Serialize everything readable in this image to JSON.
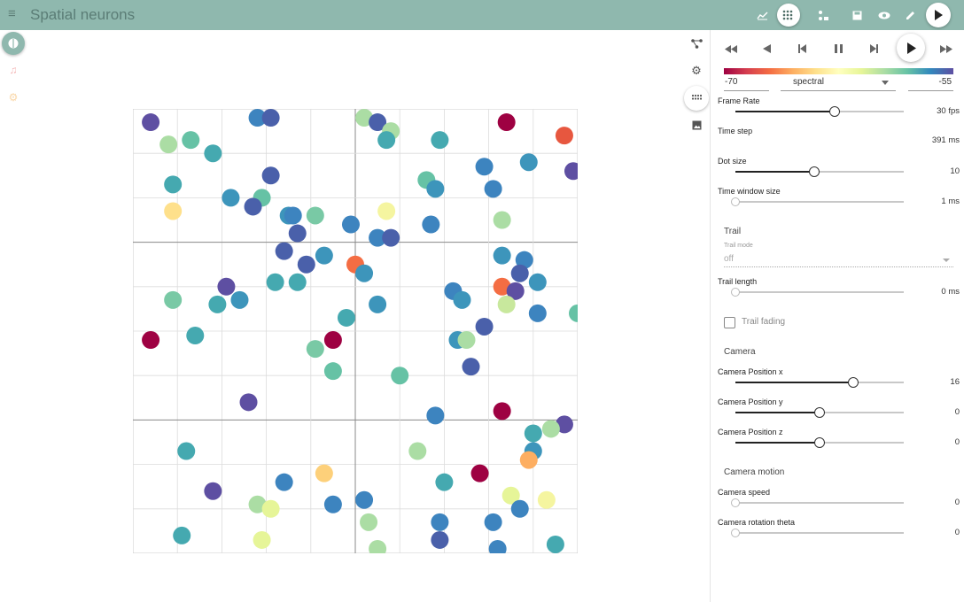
{
  "app": {
    "title": "Spatial neurons"
  },
  "topbar": {
    "icons": [
      {
        "name": "chart-icon",
        "glyph": "📈"
      },
      {
        "name": "grid-dots-icon",
        "glyph": "⋮⋮",
        "active": true
      },
      {
        "name": "model-icon",
        "glyph": "⛶"
      },
      {
        "name": "save-icon",
        "glyph": "💾"
      },
      {
        "name": "eye-icon",
        "glyph": "👁"
      },
      {
        "name": "edit-icon",
        "glyph": "✎"
      }
    ]
  },
  "left_rail": [
    {
      "name": "brain-icon",
      "color": "#ffffff"
    },
    {
      "name": "music-icon",
      "color": "#f4b6b6"
    },
    {
      "name": "settings-icon",
      "color": "#f9d7a8"
    }
  ],
  "colorbar": {
    "colormap": "spectral",
    "min_label": "-70",
    "max_label": "-55"
  },
  "controls": {
    "frame_rate": {
      "label": "Frame Rate",
      "value": "30 fps",
      "fraction": 0.59
    },
    "time_step": {
      "label": "Time step",
      "value": "391 ms"
    },
    "dot_size": {
      "label": "Dot size",
      "value": "10",
      "fraction": 0.47
    },
    "time_window": {
      "label": "Time window size",
      "value": "1 ms",
      "fraction": 0.0
    },
    "trail_section": "Trail",
    "trail_mode_label": "Trail mode",
    "trail_mode_value": "off",
    "trail_length": {
      "label": "Trail length",
      "value": "0 ms",
      "fraction": 0.0
    },
    "trail_fading": {
      "label": "Trail fading",
      "checked": false
    },
    "camera_section": "Camera",
    "camera_x": {
      "label": "Camera Position x",
      "value": "16",
      "fraction": 0.7
    },
    "camera_y": {
      "label": "Camera Position y",
      "value": "0",
      "fraction": 0.5
    },
    "camera_z": {
      "label": "Camera Position z",
      "value": "0",
      "fraction": 0.5
    },
    "camera_motion_section": "Camera motion",
    "camera_speed": {
      "label": "Camera speed",
      "value": "0",
      "fraction": 0.0
    },
    "camera_rotation_theta": {
      "label": "Camera rotation theta",
      "value": "0",
      "fraction": 0.0
    }
  },
  "chart_data": {
    "type": "scatter",
    "xlim": [
      0,
      10
    ],
    "ylim": [
      0,
      10
    ],
    "grid": true,
    "color_scale": "spectral",
    "points": [
      {
        "x": 0.4,
        "y": 9.7,
        "c": "#5e4fa2"
      },
      {
        "x": 1.3,
        "y": 9.3,
        "c": "#66c2a5"
      },
      {
        "x": 0.8,
        "y": 9.2,
        "c": "#abdda4"
      },
      {
        "x": 1.8,
        "y": 9.0,
        "c": "#45a9b0"
      },
      {
        "x": 2.8,
        "y": 9.8,
        "c": "#3d84bf"
      },
      {
        "x": 3.1,
        "y": 9.8,
        "c": "#4a60aa"
      },
      {
        "x": 5.2,
        "y": 9.8,
        "c": "#abdda4"
      },
      {
        "x": 5.5,
        "y": 9.7,
        "c": "#4a60aa"
      },
      {
        "x": 5.8,
        "y": 9.5,
        "c": "#abdda4"
      },
      {
        "x": 5.7,
        "y": 9.3,
        "c": "#45a9b0"
      },
      {
        "x": 6.9,
        "y": 9.3,
        "c": "#45a9b0"
      },
      {
        "x": 8.4,
        "y": 9.7,
        "c": "#9e0142"
      },
      {
        "x": 9.7,
        "y": 9.4,
        "c": "#e7573f"
      },
      {
        "x": 0.9,
        "y": 8.3,
        "c": "#45a9b0"
      },
      {
        "x": 3.1,
        "y": 8.5,
        "c": "#4a60aa"
      },
      {
        "x": 7.9,
        "y": 8.7,
        "c": "#3d84bf"
      },
      {
        "x": 8.9,
        "y": 8.8,
        "c": "#3d95bb"
      },
      {
        "x": 9.9,
        "y": 8.6,
        "c": "#5e4fa2"
      },
      {
        "x": 6.6,
        "y": 8.4,
        "c": "#66c2a5"
      },
      {
        "x": 6.8,
        "y": 8.2,
        "c": "#3d95bb"
      },
      {
        "x": 8.1,
        "y": 8.2,
        "c": "#3d84bf"
      },
      {
        "x": 2.2,
        "y": 8.0,
        "c": "#3d95bb"
      },
      {
        "x": 2.9,
        "y": 8.0,
        "c": "#66c2a5"
      },
      {
        "x": 2.7,
        "y": 7.8,
        "c": "#4a60aa"
      },
      {
        "x": 0.9,
        "y": 7.7,
        "c": "#fee08b"
      },
      {
        "x": 3.5,
        "y": 7.6,
        "c": "#3d95bb"
      },
      {
        "x": 3.6,
        "y": 7.6,
        "c": "#3d84bf"
      },
      {
        "x": 4.1,
        "y": 7.6,
        "c": "#79c9a5"
      },
      {
        "x": 5.7,
        "y": 7.7,
        "c": "#f5f5a0"
      },
      {
        "x": 4.9,
        "y": 7.4,
        "c": "#3d84bf"
      },
      {
        "x": 8.3,
        "y": 7.5,
        "c": "#abdda4"
      },
      {
        "x": 6.7,
        "y": 7.4,
        "c": "#3d84bf"
      },
      {
        "x": 3.7,
        "y": 7.2,
        "c": "#4a60aa"
      },
      {
        "x": 5.5,
        "y": 7.1,
        "c": "#3d84bf"
      },
      {
        "x": 5.8,
        "y": 7.1,
        "c": "#4a60aa"
      },
      {
        "x": 3.4,
        "y": 6.8,
        "c": "#4a60aa"
      },
      {
        "x": 3.9,
        "y": 6.5,
        "c": "#4a60aa"
      },
      {
        "x": 4.3,
        "y": 6.7,
        "c": "#3d95bb"
      },
      {
        "x": 5.0,
        "y": 6.5,
        "c": "#f46d43"
      },
      {
        "x": 5.2,
        "y": 6.3,
        "c": "#3d95bb"
      },
      {
        "x": 8.3,
        "y": 6.7,
        "c": "#3d95bb"
      },
      {
        "x": 8.8,
        "y": 6.6,
        "c": "#3d84bf"
      },
      {
        "x": 8.7,
        "y": 6.3,
        "c": "#4a60aa"
      },
      {
        "x": 3.2,
        "y": 6.1,
        "c": "#45a9b0"
      },
      {
        "x": 3.7,
        "y": 6.1,
        "c": "#45a9b0"
      },
      {
        "x": 2.1,
        "y": 6.0,
        "c": "#5e4fa2"
      },
      {
        "x": 9.1,
        "y": 6.1,
        "c": "#3d95bb"
      },
      {
        "x": 8.3,
        "y": 6.0,
        "c": "#f46d43"
      },
      {
        "x": 8.6,
        "y": 5.9,
        "c": "#5e4fa2"
      },
      {
        "x": 7.2,
        "y": 5.9,
        "c": "#3d84bf"
      },
      {
        "x": 7.4,
        "y": 5.7,
        "c": "#3d95bb"
      },
      {
        "x": 0.9,
        "y": 5.7,
        "c": "#79c9a5"
      },
      {
        "x": 1.9,
        "y": 5.6,
        "c": "#45a9b0"
      },
      {
        "x": 2.4,
        "y": 5.7,
        "c": "#3d95bb"
      },
      {
        "x": 5.5,
        "y": 5.6,
        "c": "#3d95bb"
      },
      {
        "x": 8.4,
        "y": 5.6,
        "c": "#c8e89d"
      },
      {
        "x": 9.1,
        "y": 5.4,
        "c": "#3d84bf"
      },
      {
        "x": 10.0,
        "y": 5.4,
        "c": "#66c2a5"
      },
      {
        "x": 4.8,
        "y": 5.3,
        "c": "#45a9b0"
      },
      {
        "x": 7.9,
        "y": 5.1,
        "c": "#4a60aa"
      },
      {
        "x": 0.4,
        "y": 4.8,
        "c": "#9e0142"
      },
      {
        "x": 1.4,
        "y": 4.9,
        "c": "#45a9b0"
      },
      {
        "x": 4.5,
        "y": 4.8,
        "c": "#9e0142"
      },
      {
        "x": 7.3,
        "y": 4.8,
        "c": "#3d95bb"
      },
      {
        "x": 7.5,
        "y": 4.8,
        "c": "#abdda4"
      },
      {
        "x": 4.1,
        "y": 4.6,
        "c": "#79c9a5"
      },
      {
        "x": 7.6,
        "y": 4.2,
        "c": "#4a60aa"
      },
      {
        "x": 4.5,
        "y": 4.1,
        "c": "#66c2a5"
      },
      {
        "x": 6.0,
        "y": 4.0,
        "c": "#66c2a5"
      },
      {
        "x": 2.6,
        "y": 3.4,
        "c": "#5e4fa2"
      },
      {
        "x": 6.8,
        "y": 3.1,
        "c": "#3d84bf"
      },
      {
        "x": 8.3,
        "y": 3.2,
        "c": "#9e0142"
      },
      {
        "x": 9.7,
        "y": 2.9,
        "c": "#5e4fa2"
      },
      {
        "x": 9.4,
        "y": 2.8,
        "c": "#abdda4"
      },
      {
        "x": 9.0,
        "y": 2.7,
        "c": "#45a9b0"
      },
      {
        "x": 9.0,
        "y": 2.3,
        "c": "#3d95bb"
      },
      {
        "x": 1.2,
        "y": 2.3,
        "c": "#45a9b0"
      },
      {
        "x": 6.4,
        "y": 2.3,
        "c": "#abdda4"
      },
      {
        "x": 8.9,
        "y": 2.1,
        "c": "#fdae61"
      },
      {
        "x": 7.8,
        "y": 1.8,
        "c": "#9e0142"
      },
      {
        "x": 4.3,
        "y": 1.8,
        "c": "#fdd07a"
      },
      {
        "x": 3.4,
        "y": 1.6,
        "c": "#3d84bf"
      },
      {
        "x": 7.0,
        "y": 1.6,
        "c": "#45a9b0"
      },
      {
        "x": 1.8,
        "y": 1.4,
        "c": "#5e4fa2"
      },
      {
        "x": 8.5,
        "y": 1.3,
        "c": "#e6f598"
      },
      {
        "x": 9.3,
        "y": 1.2,
        "c": "#f5f5a0"
      },
      {
        "x": 5.2,
        "y": 1.2,
        "c": "#3d84bf"
      },
      {
        "x": 2.8,
        "y": 1.1,
        "c": "#abdda4"
      },
      {
        "x": 3.1,
        "y": 1.0,
        "c": "#e6f598"
      },
      {
        "x": 4.5,
        "y": 1.1,
        "c": "#3d84bf"
      },
      {
        "x": 8.7,
        "y": 1.0,
        "c": "#3d84bf"
      },
      {
        "x": 5.3,
        "y": 0.7,
        "c": "#abdda4"
      },
      {
        "x": 6.9,
        "y": 0.7,
        "c": "#3d84bf"
      },
      {
        "x": 8.1,
        "y": 0.7,
        "c": "#3d84bf"
      },
      {
        "x": 1.1,
        "y": 0.4,
        "c": "#45a9b0"
      },
      {
        "x": 2.9,
        "y": 0.3,
        "c": "#e6f598"
      },
      {
        "x": 6.9,
        "y": 0.3,
        "c": "#4a60aa"
      },
      {
        "x": 9.5,
        "y": 0.2,
        "c": "#45a9b0"
      },
      {
        "x": 5.5,
        "y": 0.1,
        "c": "#abdda4"
      },
      {
        "x": 8.2,
        "y": 0.1,
        "c": "#3d84bf"
      }
    ]
  }
}
